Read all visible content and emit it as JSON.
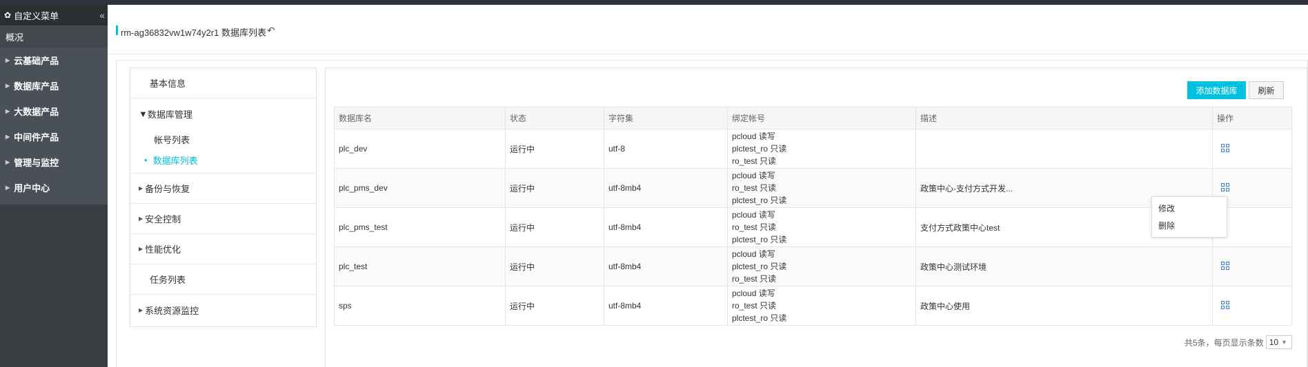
{
  "sidebar": {
    "header": "自定义菜单",
    "overview": "概况",
    "items": [
      {
        "label": "云基础产品"
      },
      {
        "label": "数据库产品"
      },
      {
        "label": "大数据产品"
      },
      {
        "label": "中间件产品"
      },
      {
        "label": "管理与监控"
      },
      {
        "label": "用户中心"
      }
    ]
  },
  "header": {
    "title": "rm-ag36832vw1w74y2r1 数据库列表"
  },
  "leftnav": {
    "basic_info": "基本信息",
    "db_mgmt": "数据库管理",
    "account_list": "帐号列表",
    "db_list": "数据库列表",
    "backup": "备份与恢复",
    "security": "安全控制",
    "perf": "性能优化",
    "tasks": "任务列表",
    "sys_monitor": "系统资源监控"
  },
  "toolbar": {
    "add_label": "添加数据库",
    "refresh_label": "刷新"
  },
  "table": {
    "columns": [
      "数据库名",
      "状态",
      "字符集",
      "绑定帐号",
      "描述",
      "操作"
    ],
    "rows": [
      {
        "name": "plc_dev",
        "status": "运行中",
        "charset": "utf-8",
        "accounts": [
          "pcloud 读写",
          "plctest_ro 只读",
          "ro_test 只读"
        ],
        "desc": ""
      },
      {
        "name": "plc_pms_dev",
        "status": "运行中",
        "charset": "utf-8mb4",
        "accounts": [
          "pcloud 读写",
          "ro_test 只读",
          "plctest_ro 只读"
        ],
        "desc": "政策中心-支付方式开发..."
      },
      {
        "name": "plc_pms_test",
        "status": "运行中",
        "charset": "utf-8mb4",
        "accounts": [
          "pcloud 读写",
          "ro_test 只读",
          "plctest_ro 只读"
        ],
        "desc": "支付方式政策中心test"
      },
      {
        "name": "plc_test",
        "status": "运行中",
        "charset": "utf-8mb4",
        "accounts": [
          "pcloud 读写",
          "plctest_ro 只读",
          "ro_test 只读"
        ],
        "desc": "政策中心测试环境"
      },
      {
        "name": "sps",
        "status": "运行中",
        "charset": "utf-8mb4",
        "accounts": [
          "pcloud 读写",
          "ro_test 只读",
          "plctest_ro 只读"
        ],
        "desc": "政策中心使用"
      }
    ]
  },
  "popup": {
    "edit": "修改",
    "delete": "删除"
  },
  "pager": {
    "summary": "共5条，每页显示条数",
    "page_size": "10"
  },
  "colors": {
    "accent": "#00c1de",
    "status_running": "#3cb034",
    "sidebar_bg": "#373d41"
  }
}
